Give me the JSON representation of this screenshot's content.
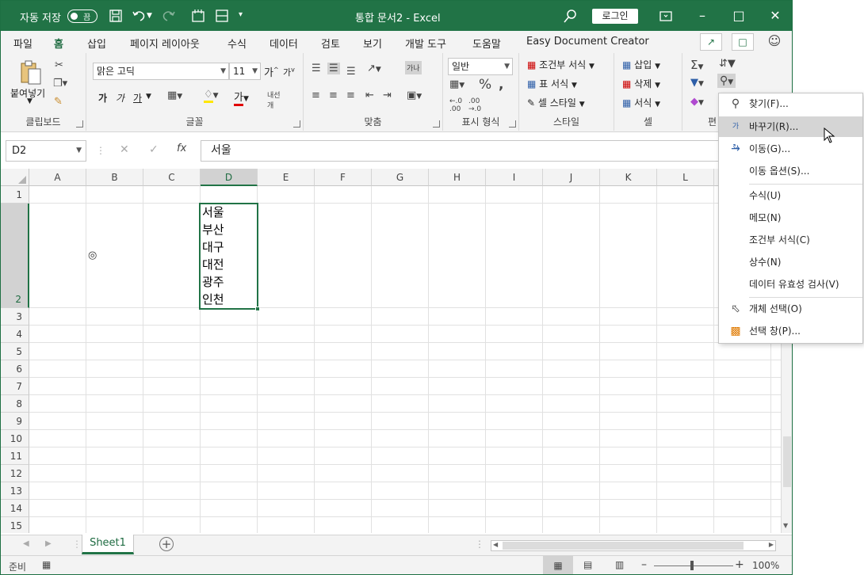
{
  "titlebar": {
    "autosave_label": "자동 저장",
    "autosave_state": "끔",
    "doc_title": "통합 문서2  -  Excel",
    "login_label": "로그인"
  },
  "tabs": [
    "파일",
    "홈",
    "삽입",
    "페이지 레이아웃",
    "수식",
    "데이터",
    "검토",
    "보기",
    "개발 도구",
    "도움말",
    "Easy Document Creator"
  ],
  "ribbon": {
    "clipboard": {
      "paste": "붙여넣기",
      "label": "클립보드"
    },
    "font": {
      "name": "맑은 고딕",
      "size": "11",
      "bold": "가",
      "italic": "가",
      "underline": "가",
      "label": "글꼴",
      "grow": "가",
      "shrink": "가"
    },
    "align": {
      "label": "맞춤",
      "wrap": "가나"
    },
    "number": {
      "format": "일반",
      "label": "표시 형식"
    },
    "styles": {
      "cond": "조건부 서식",
      "table": "표 서식",
      "cell": "셀 스타일",
      "label": "스타일"
    },
    "cells": {
      "insert": "삽입",
      "delete": "삭제",
      "format": "서식",
      "label": "셀"
    },
    "editing": {
      "label": "편"
    }
  },
  "formula_bar": {
    "name_box": "D2",
    "value": "서울"
  },
  "columns": [
    "A",
    "B",
    "C",
    "D",
    "E",
    "F",
    "G",
    "H",
    "I",
    "J",
    "K",
    "L"
  ],
  "rows": [
    "1",
    "2",
    "3",
    "4",
    "5",
    "6",
    "7",
    "8",
    "9",
    "10",
    "11",
    "12",
    "13",
    "14",
    "15"
  ],
  "cell_d2": [
    "서울",
    "부산",
    "대구",
    "대전",
    "광주",
    "인천"
  ],
  "cursor_mark": "◎",
  "sheet": {
    "name": "Sheet1"
  },
  "status": {
    "ready": "준비",
    "zoom": "100%"
  },
  "find_menu": [
    {
      "label": "찾기(F)...",
      "icon": "search-icon"
    },
    {
      "label": "바꾸기(R)...",
      "icon": "replace-icon"
    },
    {
      "label": "이동(G)...",
      "icon": "arrow-right-icon"
    },
    {
      "label": "이동 옵션(S)..."
    },
    {
      "label": "수식(U)"
    },
    {
      "label": "메모(N)"
    },
    {
      "label": "조건부 서식(C)"
    },
    {
      "label": "상수(N)"
    },
    {
      "label": "데이터 유효성 검사(V)"
    },
    {
      "label": "개체 선택(O)",
      "icon": "pointer-icon"
    },
    {
      "label": "선택 창(P)...",
      "icon": "selection-pane-icon"
    }
  ],
  "colors": {
    "accent": "#217346",
    "ribbon_bg": "#f3f3f3"
  }
}
